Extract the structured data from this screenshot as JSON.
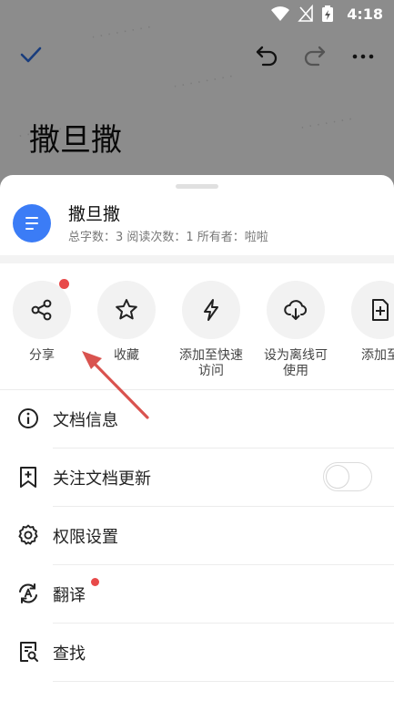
{
  "status_bar": {
    "time": "4:18"
  },
  "document": {
    "title": "撒旦撒",
    "meta": "总字数：3 阅读次数：1 所有者：啦啦"
  },
  "actions": [
    {
      "label": "分享",
      "icon": "share-icon"
    },
    {
      "label": "收藏",
      "icon": "star-icon"
    },
    {
      "label": "添加至快速访问",
      "label_lines": [
        "添加至快速",
        "访问"
      ],
      "icon": "lightning-icon"
    },
    {
      "label": "设为离线可使用",
      "label_lines": [
        "设为离线可",
        "使用"
      ],
      "icon": "cloud-download-icon"
    },
    {
      "label": "添加至",
      "icon": "add-file-icon"
    }
  ],
  "menu": [
    {
      "label": "文档信息",
      "icon": "info-icon"
    },
    {
      "label": "关注文档更新",
      "icon": "bookmark-add-icon",
      "toggle": false
    },
    {
      "label": "权限设置",
      "icon": "gear-icon"
    },
    {
      "label": "翻译",
      "icon": "translate-icon"
    },
    {
      "label": "查找",
      "icon": "find-in-doc-icon"
    }
  ],
  "colors": {
    "accent": "#3b7cf6",
    "badge": "#e84a4a",
    "annotation_arrow": "#d9534f"
  }
}
